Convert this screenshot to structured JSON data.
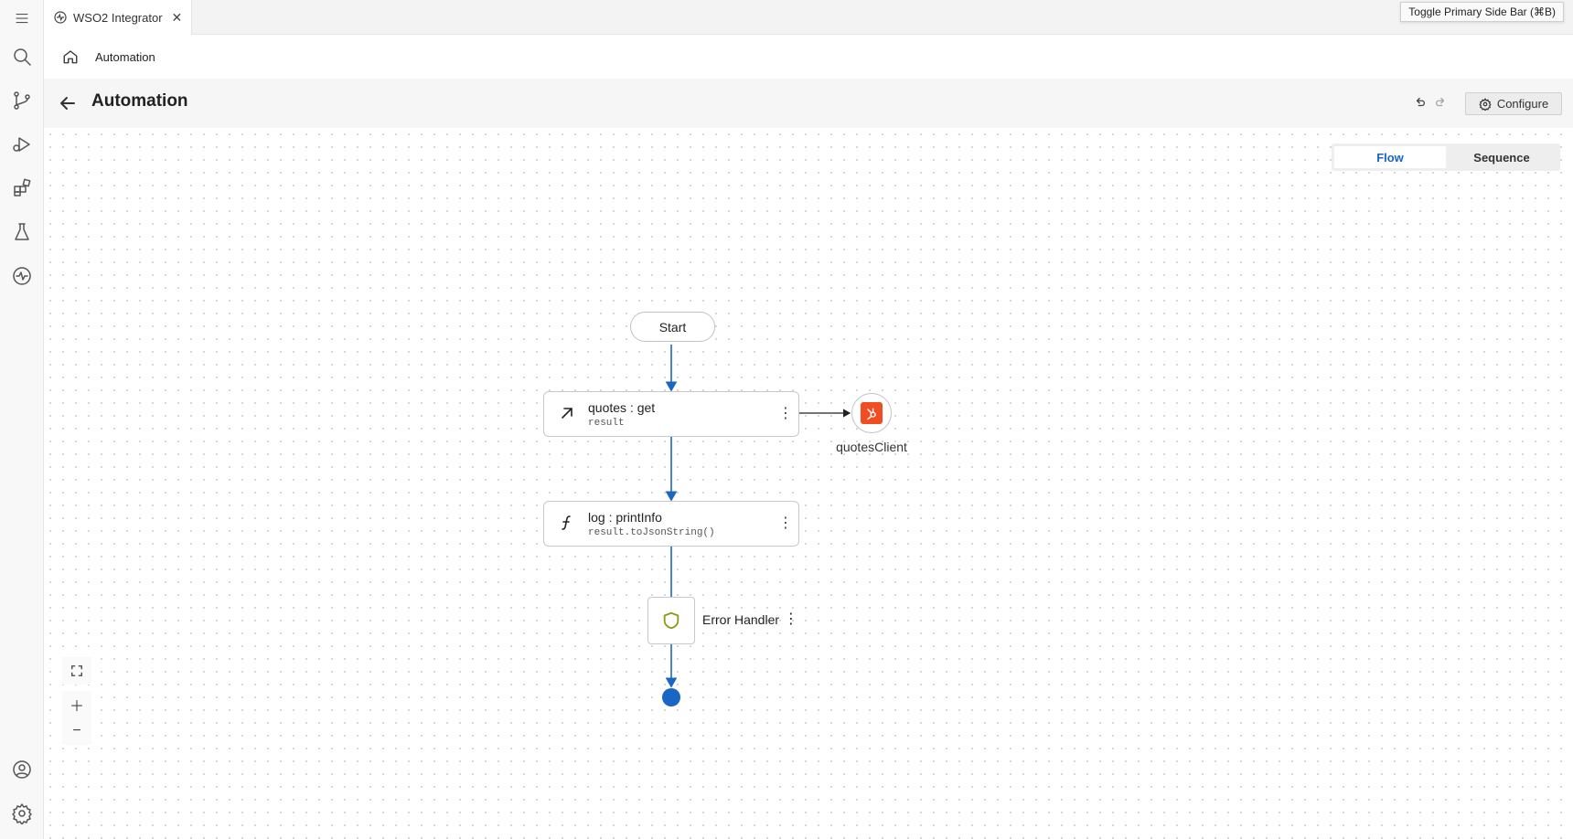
{
  "tab": {
    "title": "WSO2 Integrator",
    "icon": "pulse-icon"
  },
  "tooltip": {
    "text": "Toggle Primary Side Bar (⌘B)"
  },
  "breadcrumb": {
    "label": "Automation"
  },
  "header": {
    "title": "Automation",
    "configure_label": "Configure"
  },
  "view_toggle": {
    "options": [
      "Flow",
      "Sequence"
    ],
    "selected": "Flow"
  },
  "diagram": {
    "start": {
      "label": "Start"
    },
    "nodes": [
      {
        "title": "quotes : get",
        "subtitle": "result",
        "icon": "arrow-up-right-icon"
      },
      {
        "title": "log : printInfo",
        "subtitle": "result.toJsonString()",
        "icon": "function-icon"
      }
    ],
    "client": {
      "label": "quotesClient",
      "icon": "hubspot-icon"
    },
    "error_handler": {
      "label": "Error Handler",
      "icon": "shield-icon"
    }
  },
  "colors": {
    "accent": "#1a66c5",
    "client_logo": "#f04d23",
    "shield": "#8a9a1a"
  }
}
